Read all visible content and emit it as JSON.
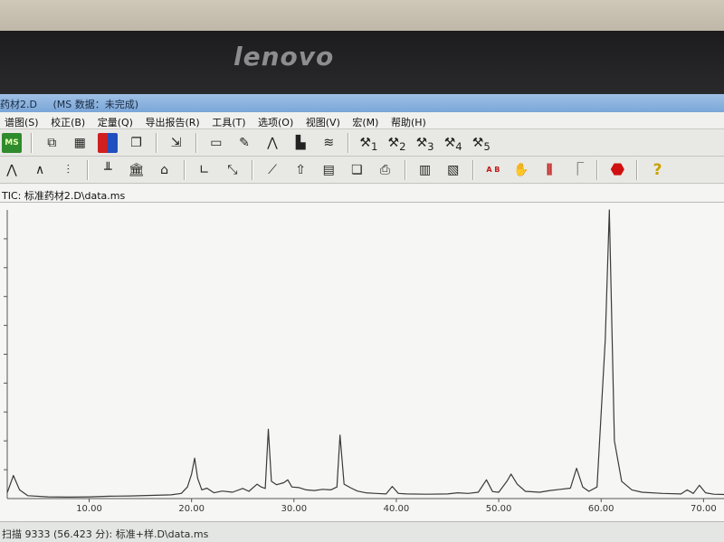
{
  "bezel": {
    "brand": "lenovo"
  },
  "window": {
    "title": "药材2.D",
    "mode": "(MS 数据：未完成)"
  },
  "menu": [
    "谱图(S)",
    "校正(B)",
    "定量(Q)",
    "导出报告(R)",
    "工具(T)",
    "选项(O)",
    "视图(V)",
    "宏(M)",
    "帮助(H)"
  ],
  "toolbar1": {
    "icons": [
      "ms-data-icon",
      "copy-icon",
      "color-grid-icon",
      "multicolor-icon",
      "window-icon",
      "export-icon",
      "text-icon",
      "annotate-icon",
      "peak-icon",
      "bar-peak-icon",
      "chromatogram-icon",
      "macro-1-icon",
      "macro-2-icon",
      "macro-3-icon",
      "macro-4-icon",
      "macro-5-icon"
    ],
    "macro_labels": [
      "1",
      "2",
      "3",
      "4",
      "5"
    ]
  },
  "toolbar2": {
    "icons": [
      "peaks-icon",
      "small-peaks-icon",
      "integrate-icon",
      "baseline-icon",
      "library-icon",
      "library-search-icon",
      "axis-icon",
      "zoom-icon",
      "calibrate-icon",
      "up-arrow-icon",
      "report-icon",
      "page-icon",
      "print-icon",
      "document-icon",
      "document-export-icon",
      "compare-ab-icon",
      "hand-icon",
      "split-icon",
      "step-icon",
      "stop-icon",
      "help-icon"
    ],
    "compare_label": "A B",
    "help_label": "?"
  },
  "chart_header": {
    "label": "TIC: 标准药材2.D\\data.ms"
  },
  "statusbar": {
    "text": "扫描 9333 (56.423 分): 标准+样.D\\data.ms"
  },
  "chart_data": {
    "type": "line",
    "title": "",
    "xlabel": "",
    "ylabel": "",
    "xlim": [
      2,
      72
    ],
    "ylim": [
      0,
      100
    ],
    "x_ticks": [
      "10.00",
      "20.00",
      "30.00",
      "40.00",
      "50.00",
      "60.00",
      "70.00"
    ],
    "x_tick_values": [
      10,
      20,
      30,
      40,
      50,
      60,
      70
    ],
    "y_tick_values": [
      10,
      20,
      30,
      40,
      50,
      60,
      70,
      80,
      90
    ],
    "line_color": "#3a3a3a",
    "series": [
      {
        "points": [
          [
            2,
            2
          ],
          [
            2.6,
            8
          ],
          [
            3.2,
            3
          ],
          [
            4,
            1
          ],
          [
            6,
            0.6
          ],
          [
            8,
            0.5
          ],
          [
            10,
            0.6
          ],
          [
            12,
            0.8
          ],
          [
            14,
            0.9
          ],
          [
            16,
            1.1
          ],
          [
            18,
            1.3
          ],
          [
            19,
            1.8
          ],
          [
            19.6,
            4
          ],
          [
            20,
            8.5
          ],
          [
            20.3,
            14
          ],
          [
            20.6,
            7
          ],
          [
            21,
            3
          ],
          [
            21.5,
            3.6
          ],
          [
            22.2,
            2
          ],
          [
            23,
            2.6
          ],
          [
            24,
            2.2
          ],
          [
            25,
            3.5
          ],
          [
            25.6,
            2.5
          ],
          [
            26.4,
            5
          ],
          [
            26.8,
            4
          ],
          [
            27.2,
            3.5
          ],
          [
            27.5,
            24
          ],
          [
            27.8,
            6
          ],
          [
            28.3,
            4.8
          ],
          [
            29,
            5.5
          ],
          [
            29.4,
            6.5
          ],
          [
            29.8,
            4
          ],
          [
            30.5,
            3.8
          ],
          [
            31.2,
            3
          ],
          [
            32,
            2.8
          ],
          [
            32.8,
            3.2
          ],
          [
            33.6,
            3
          ],
          [
            34.2,
            4
          ],
          [
            34.5,
            22
          ],
          [
            34.9,
            5
          ],
          [
            35.6,
            3.6
          ],
          [
            36.2,
            2.6
          ],
          [
            37,
            2
          ],
          [
            38,
            1.8
          ],
          [
            39,
            1.6
          ],
          [
            39.6,
            4.2
          ],
          [
            40.2,
            1.8
          ],
          [
            41,
            1.6
          ],
          [
            43,
            1.5
          ],
          [
            45,
            1.6
          ],
          [
            46,
            2
          ],
          [
            47,
            1.8
          ],
          [
            48,
            2.2
          ],
          [
            48.8,
            6.5
          ],
          [
            49.4,
            2.4
          ],
          [
            50,
            2.2
          ],
          [
            50.8,
            6
          ],
          [
            51.2,
            8.5
          ],
          [
            51.8,
            5
          ],
          [
            52.6,
            2.5
          ],
          [
            54,
            2.2
          ],
          [
            55,
            2.8
          ],
          [
            56,
            3.2
          ],
          [
            57,
            3.6
          ],
          [
            57.6,
            10.5
          ],
          [
            58.2,
            4
          ],
          [
            58.8,
            2.5
          ],
          [
            59.6,
            4
          ],
          [
            60.4,
            55
          ],
          [
            60.8,
            100
          ],
          [
            61.3,
            20
          ],
          [
            62,
            6
          ],
          [
            63,
            3
          ],
          [
            64,
            2.2
          ],
          [
            66,
            1.8
          ],
          [
            67.8,
            1.6
          ],
          [
            68.4,
            3
          ],
          [
            69,
            1.8
          ],
          [
            69.6,
            4.6
          ],
          [
            70.2,
            2
          ],
          [
            71,
            1.5
          ],
          [
            72,
            1.4
          ]
        ]
      }
    ]
  }
}
